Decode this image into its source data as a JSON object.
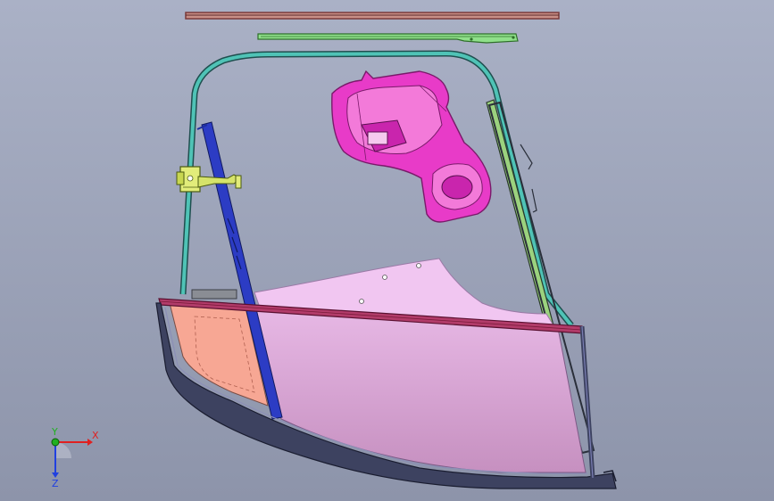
{
  "viewport": {
    "background_top": "#aab1c6",
    "background_bottom": "#8d94aa"
  },
  "parts": {
    "top_rail_color": "#7a3b3b",
    "upper_bracket_color": "#3f8f3a",
    "frame_tube_color": "#2f9b9b",
    "blue_guide_color": "#2c3cc4",
    "magenta_bracket_color": "#e83bc8",
    "lock_mechanism_color": "#d6e36a",
    "belt_molding_color": "#a0305c",
    "door_panel_color": "#e9b7e5",
    "glass_color": "#f0c4f0",
    "orange_panel_color": "#f6a690",
    "seal_color": "#4a4e6b"
  },
  "triad": {
    "x_label": "X",
    "y_label": "Y",
    "z_label": "Z",
    "x_color": "#e02020",
    "y_color": "#20b020",
    "z_color": "#2040e0"
  }
}
